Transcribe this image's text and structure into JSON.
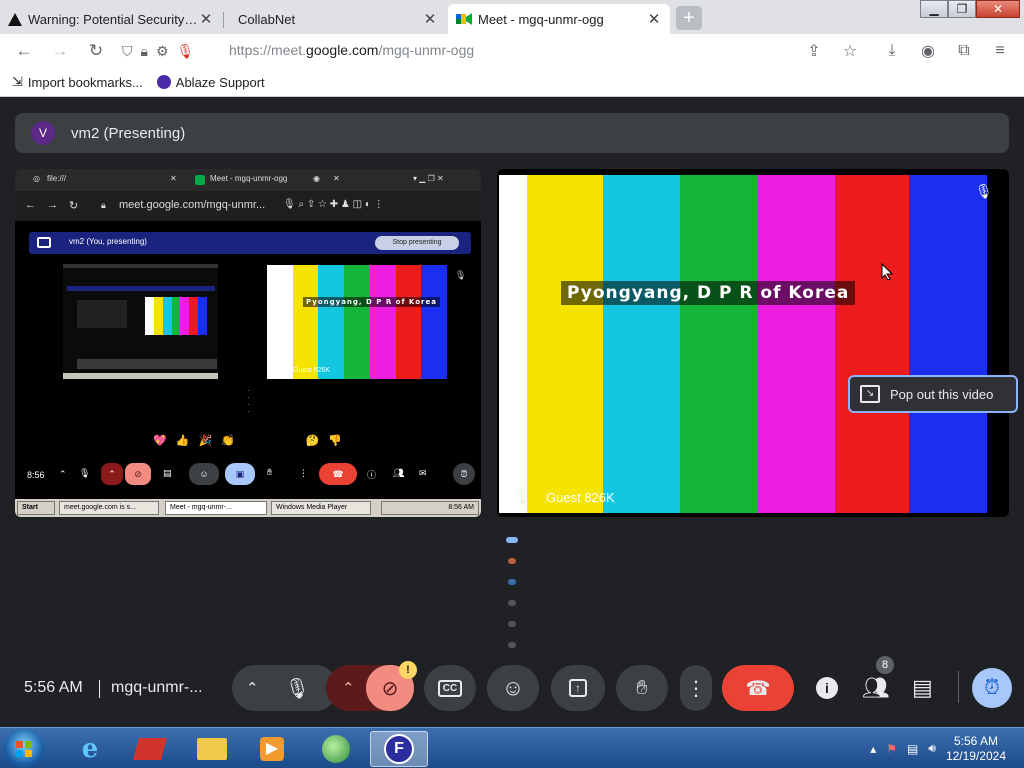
{
  "browser": {
    "tabs": [
      {
        "title": "Warning: Potential Security Risk"
      },
      {
        "title": "CollabNet"
      },
      {
        "title": "Meet - mgq-unmr-ogg"
      }
    ],
    "url_prefix": "https://meet.",
    "url_domain": "google.com",
    "url_path": "/mgq-unmr-ogg",
    "bookmarks": [
      {
        "label": "Import bookmarks..."
      },
      {
        "label": "Ablaze Support"
      }
    ]
  },
  "meet": {
    "presenter_initial": "V",
    "presenter_title": "vm2 (Presenting)",
    "nested": {
      "tab1": "file:///",
      "tab2": "Meet - mgq-unmr-ogg",
      "url": "meet.google.com/mgq-unmr...",
      "presenting_label": "vm2 (You, presenting)",
      "stop_label": "Stop presenting",
      "time": "8:56",
      "reactions": "💖 👍 🎉 👏 😆 😮 😢 🤔 👎",
      "taskbar_start": "Start",
      "taskbar_items": [
        "meet.google.com is s...",
        "Meet - mgq-unmr-...",
        "Windows Media Player"
      ],
      "taskbar_clock": "8:56 AM",
      "tv_caption": "Pyongyang, D P R of Korea",
      "guest_label": "Guest 826K"
    },
    "main_video": {
      "caption": "Pyongyang, D P R of Korea",
      "guest_label": "Guest 826K"
    },
    "popout_label": "Pop out this video",
    "participant_count": "8",
    "camera_warning": "!"
  },
  "controls": {
    "time": "5:56 AM",
    "meeting_code": "mgq-unmr-..."
  },
  "taskbar": {
    "time": "5:56 AM",
    "date": "12/19/2024"
  },
  "colors": {
    "bar_colors": [
      "#ffffff",
      "#f5e400",
      "#14c7e0",
      "#13b53a",
      "#ee1ee0",
      "#ec1c1c",
      "#1a2ff0"
    ],
    "end_call": "#ea4335",
    "accent": "#8ab4f8"
  }
}
